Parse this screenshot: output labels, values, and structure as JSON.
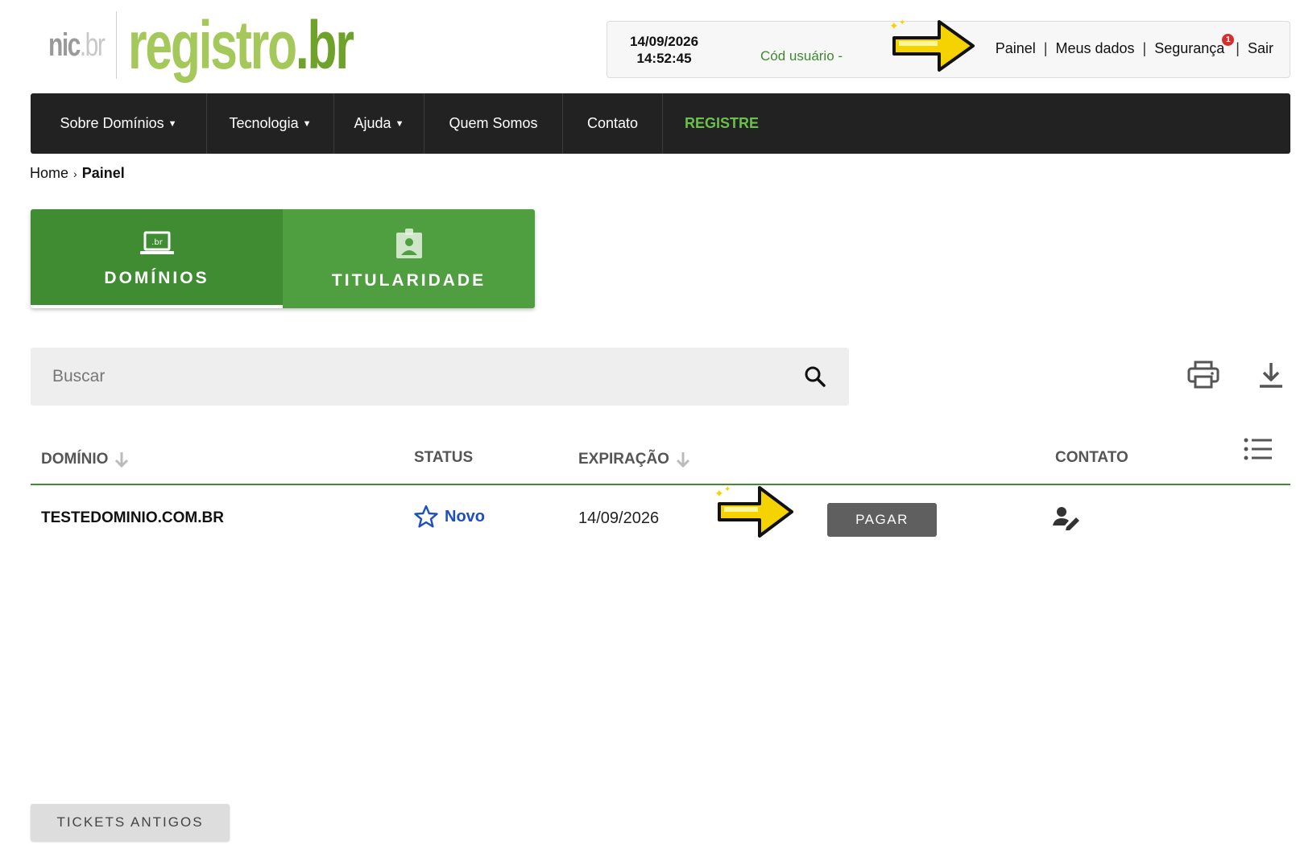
{
  "header": {
    "logo_nic": "nic",
    "logo_nic_suffix": ".br",
    "logo_registro": "registro",
    "logo_registro_suffix": ".br",
    "date": "14/09/2026",
    "time": "14:52:45",
    "user_code_label": "Cód usuário - ",
    "links": [
      "Painel",
      "Meus dados",
      "Segurança",
      "Sair"
    ],
    "security_badge": "1"
  },
  "nav": {
    "items": [
      {
        "label": "Sobre Domínios",
        "dropdown": true
      },
      {
        "label": "Tecnologia",
        "dropdown": true
      },
      {
        "label": "Ajuda",
        "dropdown": true
      },
      {
        "label": "Quem Somos",
        "dropdown": false
      },
      {
        "label": "Contato",
        "dropdown": false
      },
      {
        "label": "REGISTRE",
        "dropdown": false
      }
    ],
    "register_color": "#6bc04b"
  },
  "breadcrumb": {
    "home": "Home",
    "current": "Painel"
  },
  "tabs": [
    {
      "label": "DOMÍNIOS",
      "icon": "laptop-br-icon",
      "active": true
    },
    {
      "label": "TITULARIDADE",
      "icon": "id-badge-icon",
      "active": false
    }
  ],
  "search": {
    "placeholder": "Buscar",
    "value": ""
  },
  "table": {
    "columns": [
      "DOMÍNIO",
      "STATUS",
      "EXPIRAÇÃO",
      "CONTATO"
    ],
    "rows": [
      {
        "domain": "TESTEDOMINIO.COM.BR",
        "status": "Novo",
        "expiration": "14/09/2026",
        "action": "PAGAR"
      }
    ]
  },
  "footer": {
    "old_tickets_label": "TICKETS ANTIGOS"
  },
  "colors": {
    "green_dark": "#3f8c33",
    "green": "#4f9e3f",
    "status_blue": "#1e4fc2",
    "nav_bg": "#222222"
  }
}
